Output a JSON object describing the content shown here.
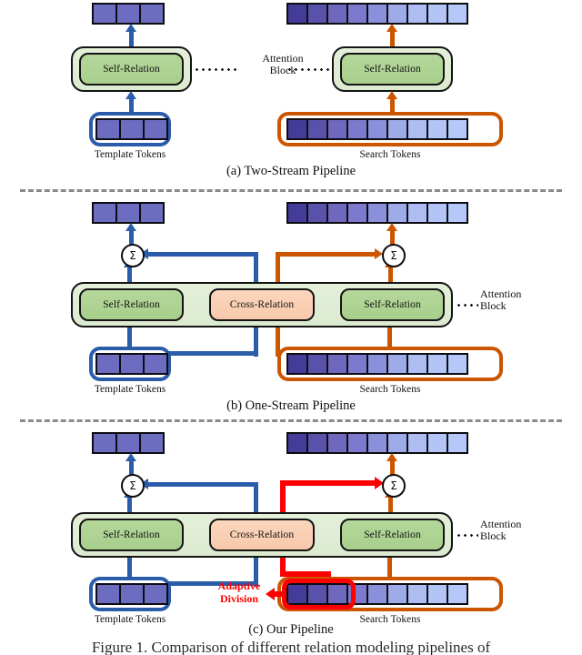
{
  "figure": {
    "caption_cut": "Figure 1.   Comparison   of  different   relation   modeling   pipelines   of"
  },
  "labels": {
    "self_relation": "Self-Relation",
    "cross_relation": "Cross-Relation",
    "attention_block_line1": "Attention",
    "attention_block_line2": "Block",
    "template_tokens": "Template Tokens",
    "search_tokens": "Search Tokens",
    "sigma": "Σ",
    "adaptive_line1": "Adaptive",
    "adaptive_line2": "Division"
  },
  "panels": [
    {
      "id": "a",
      "title": "(a) Two-Stream Pipeline"
    },
    {
      "id": "b",
      "title": "(b) One-Stream Pipeline"
    },
    {
      "id": "c",
      "title": "(c) Our Pipeline"
    }
  ],
  "colors": {
    "template_token": "#6c6cc0",
    "template_border": "#2a5caa",
    "search_border": "#cc5500",
    "self_relation": "#b0d495",
    "cross_relation": "#f9cfb1",
    "attention_shell": "#e0edd6",
    "adaptive_division": "#ff0000",
    "divider": "#8a8a8a",
    "outline": "#0d0d12"
  },
  "tokens": {
    "template_count": 3,
    "template_colors": [
      "#6c6cc0",
      "#6c6cc0",
      "#6c6cc0"
    ],
    "search_count": 9,
    "search_colors": [
      "#453c9a",
      "#5a51ab",
      "#6f68bd",
      "#7d7ace",
      "#8b90da",
      "#9fabe8",
      "#aebdf2",
      "#b3c4f7",
      "#b6c7f9"
    ],
    "adaptive_division_selected": 3
  }
}
